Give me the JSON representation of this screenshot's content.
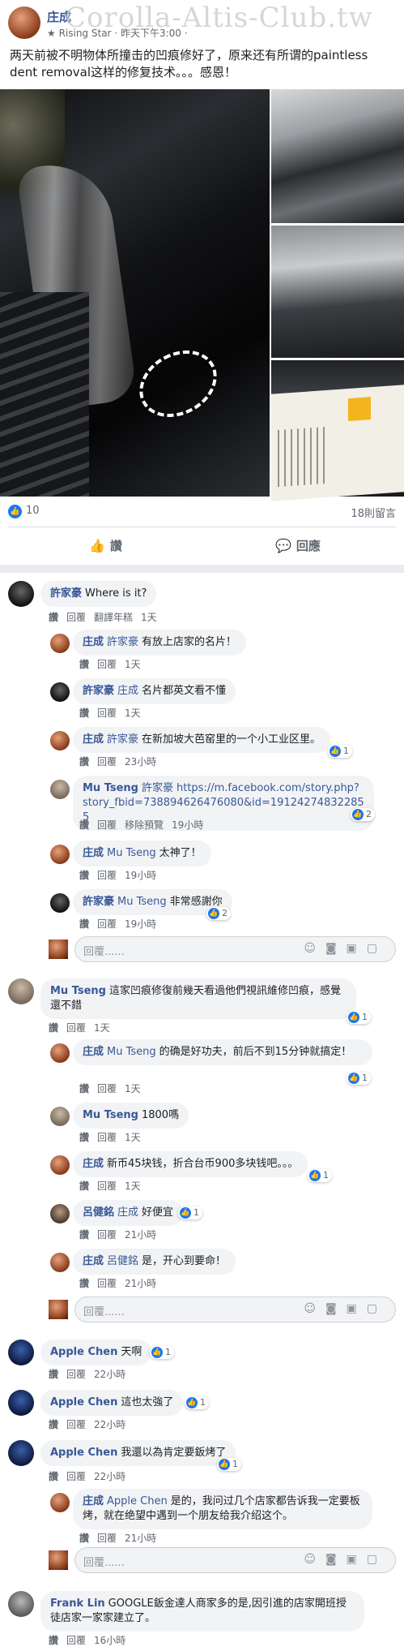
{
  "post": {
    "author": "庄成",
    "badge": "★ Rising Star",
    "time": "· 昨天下午3:00 ·",
    "watermark": "Corolla-Altis-Club.tw",
    "text": "两天前被不明物体所撞击的凹痕修好了，原来还有所谓的paintless dent removal这样的修复技术。。。感恩！",
    "likes": "10",
    "shares": "18則留言",
    "like_label": "讚",
    "reply_label": "回應"
  },
  "comments": [
    {
      "name": "許家豪",
      "text": "Where is it?",
      "actions": [
        "讚",
        "回覆",
        "翻譯年糕",
        "1天"
      ]
    },
    {
      "name": "庄成",
      "tag": "許家豪",
      "text": "有放上店家的名片！",
      "actions": [
        "讚",
        "回覆",
        "1天"
      ]
    },
    {
      "name": "許家豪",
      "tag": "庄成",
      "text": "名片都英文看不懂",
      "actions": [
        "讚",
        "回覆",
        "1天"
      ]
    },
    {
      "name": "庄成",
      "tag": "許家豪",
      "text": "在新加坡大芭窑里的一个小工业区里。",
      "actions": [
        "讚",
        "回覆",
        "23小時"
      ],
      "react": "1"
    },
    {
      "name": "Mu Tseng",
      "tag": "許家豪",
      "text": "https://m.facebook.com/story.php?story_fbid=738894626476080&id=191242748322855",
      "actions": [
        "讚",
        "回覆",
        "移除預覽",
        "19小時"
      ],
      "react": "2"
    },
    {
      "name": "庄成",
      "tag": "Mu Tseng",
      "text": "太神了！",
      "actions": [
        "讚",
        "回覆",
        "19小時"
      ]
    },
    {
      "name": "許家豪",
      "tag": "Mu Tseng",
      "text": "非常感謝你",
      "actions": [
        "讚",
        "回覆",
        "19小時"
      ],
      "react": "2"
    },
    {
      "name": "Mu Tseng",
      "text": "這家凹痕修復前幾天看過他們視訊維修凹痕，感覺還不錯",
      "actions": [
        "讚",
        "回覆",
        "1天"
      ],
      "react": "1"
    },
    {
      "name": "庄成",
      "tag": "Mu Tseng",
      "text": "的确是好功夫，前后不到15分钟就搞定！",
      "actions": [
        "讚",
        "回覆",
        "1天"
      ],
      "react": "1"
    },
    {
      "name": "Mu Tseng",
      "text": "1800嗎",
      "actions": [
        "讚",
        "回覆",
        "1天"
      ]
    },
    {
      "name": "庄成",
      "text": "新币45块钱，折合台币900多块钱吧。。。",
      "actions": [
        "讚",
        "回覆",
        "1天"
      ],
      "react": "1"
    },
    {
      "name": "呂健銘",
      "tag": "庄成",
      "text": "好便宜",
      "actions": [
        "讚",
        "回覆",
        "21小時"
      ],
      "react": "1"
    },
    {
      "name": "庄成",
      "tag": "呂健銘",
      "text": "是，开心到要命！",
      "actions": [
        "讚",
        "回覆",
        "21小時"
      ]
    },
    {
      "name": "Apple Chen",
      "text": "天啊",
      "actions": [
        "讚",
        "回覆",
        "22小時"
      ],
      "react": "1"
    },
    {
      "name": "Apple Chen",
      "text": "這也太強了",
      "actions": [
        "讚",
        "回覆",
        "22小時"
      ],
      "react": "1"
    },
    {
      "name": "Apple Chen",
      "text": "我還以為肯定要鈑烤了",
      "actions": [
        "讚",
        "回覆",
        "22小時"
      ],
      "react": "1"
    },
    {
      "name": "庄成",
      "tag": "Apple Chen",
      "text": "是的，我问过几个店家都告诉我一定要板烤，就在绝望中遇到一个朋友给我介绍这个。",
      "actions": [
        "讚",
        "回覆",
        "21小時"
      ]
    },
    {
      "name": "Frank Lin",
      "text": "GOOGLE鈑金達人商家多的是,因引進的店家開班授徒店家一家家建立了。",
      "actions": [
        "讚",
        "回覆",
        "16小時"
      ]
    }
  ],
  "reply_placeholder": "回覆......",
  "reply_icons": "☺◙▣▢"
}
